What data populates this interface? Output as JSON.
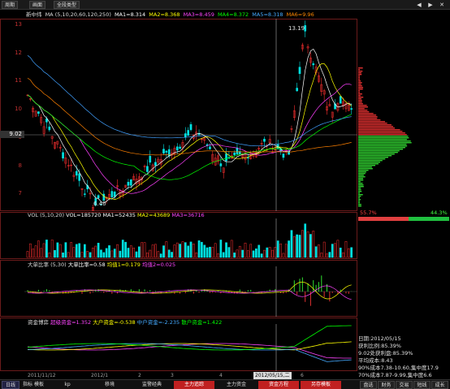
{
  "toolbar": {
    "period": "周期",
    "view": "画面",
    "stocktype": "全段类型",
    "right_icons": [
      "◀",
      "▶",
      "✕"
    ]
  },
  "main_chart": {
    "stock_name": "新中纬",
    "ma_params": "MA (5,10,20,60,120,250)",
    "ma1": "MA1=8.314",
    "ma2": "MA2=8.368",
    "ma3": "MA3=8.459",
    "ma4": "MA4=8.372",
    "ma5": "MA5=8.318",
    "ma6": "MA6=9.96",
    "high_label": "13.19",
    "low_label": "6.40",
    "cursor_price": "9.02",
    "y_ticks": [
      "13",
      "12",
      "11",
      "10",
      "9",
      "8",
      "7"
    ]
  },
  "vol_chart": {
    "title": "VOL (5,10,20)",
    "vol": "VOL=185720",
    "ma1": "MA1=52435",
    "ma2": "MA2=43689",
    "ma3": "MA3=36716",
    "y_ticks": [
      "",
      "",
      "",
      "",
      ""
    ]
  },
  "ratio_chart": {
    "title": "大单比率 (5,30)",
    "ratio": "大单比率=0.58",
    "avg1": "均值1=0.179",
    "avg2": "均值2=0.025"
  },
  "flow_chart": {
    "title": "资金博弈",
    "super": "超级资金=1.352",
    "big": "大户资金=-0.538",
    "mid": "中户资金=-2.235",
    "small": "散户资金=1.422"
  },
  "dates": {
    "d1": "2011/11/12",
    "d2": "2012/1",
    "d3": "2",
    "d4": "3",
    "d5": "4",
    "cursor_date": "2012/05/15,二",
    "d6": "6"
  },
  "side": {
    "pct_left": "55.7%",
    "pct_right": "44.3%",
    "stats": [
      "日期:2012/05/15",
      "获利比例:85.39%",
      "9.02处获利盘:85.39%",
      "平均成本:8.43",
      "90%成本7.38-10.60,集中度17.9",
      "70%成本7.87-9.99,集中度6.6"
    ]
  },
  "bottom_tabs": [
    "日线",
    "指标 模板",
    "kp",
    "移境",
    "监警经典",
    "主力追踪",
    "主力资金",
    "资金方程",
    "另存模板"
  ],
  "right_tabs": [
    "盘选",
    "财务",
    "交易",
    "短线",
    "成长"
  ],
  "colors": {
    "up": "#ff3030",
    "down": "#00e0e0",
    "ma1": "#ffffff",
    "ma2": "#ffff00",
    "ma3": "#ff40ff",
    "ma4": "#00ff00",
    "ma5": "#40a0ff",
    "ma6": "#ff8000"
  }
}
